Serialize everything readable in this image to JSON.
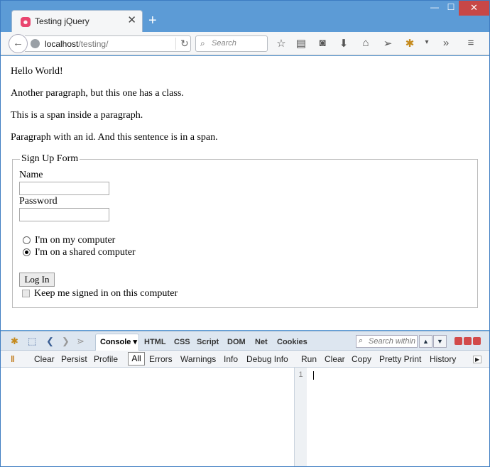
{
  "browser": {
    "tab_title": "Testing jQuery",
    "tab_close": "✕",
    "new_tab": "+",
    "url_host": "localhost",
    "url_path": "/testing/",
    "search_placeholder": "Search",
    "window_controls": {
      "minimize": "—",
      "maximize": "☐",
      "close": "✕"
    }
  },
  "page": {
    "paragraphs": [
      "Hello World!",
      "Another paragraph, but this one has a class.",
      "This is a span inside a paragraph.",
      "Paragraph with an id. And this sentence is in a span."
    ],
    "form": {
      "legend": "Sign Up Form",
      "name_label": "Name",
      "password_label": "Password",
      "radio_options": [
        {
          "label": "I'm on my computer",
          "checked": false
        },
        {
          "label": "I'm on a shared computer",
          "checked": true
        }
      ],
      "login_button": "Log In",
      "remember_label": "Keep me signed in on this computer",
      "remember_checked": false
    }
  },
  "firebug": {
    "active_tab": "Console",
    "tabs": [
      "HTML",
      "CSS",
      "Script",
      "DOM",
      "Net",
      "Cookies"
    ],
    "search_placeholder": "Search within C",
    "console_toolbar": [
      "Clear",
      "Persist",
      "Profile"
    ],
    "filter_selected": "All",
    "filters": [
      "Errors",
      "Warnings",
      "Info",
      "Debug Info"
    ],
    "command_toolbar": [
      "Run",
      "Clear",
      "Copy",
      "Pretty Print",
      "History"
    ],
    "line_number": "1"
  }
}
